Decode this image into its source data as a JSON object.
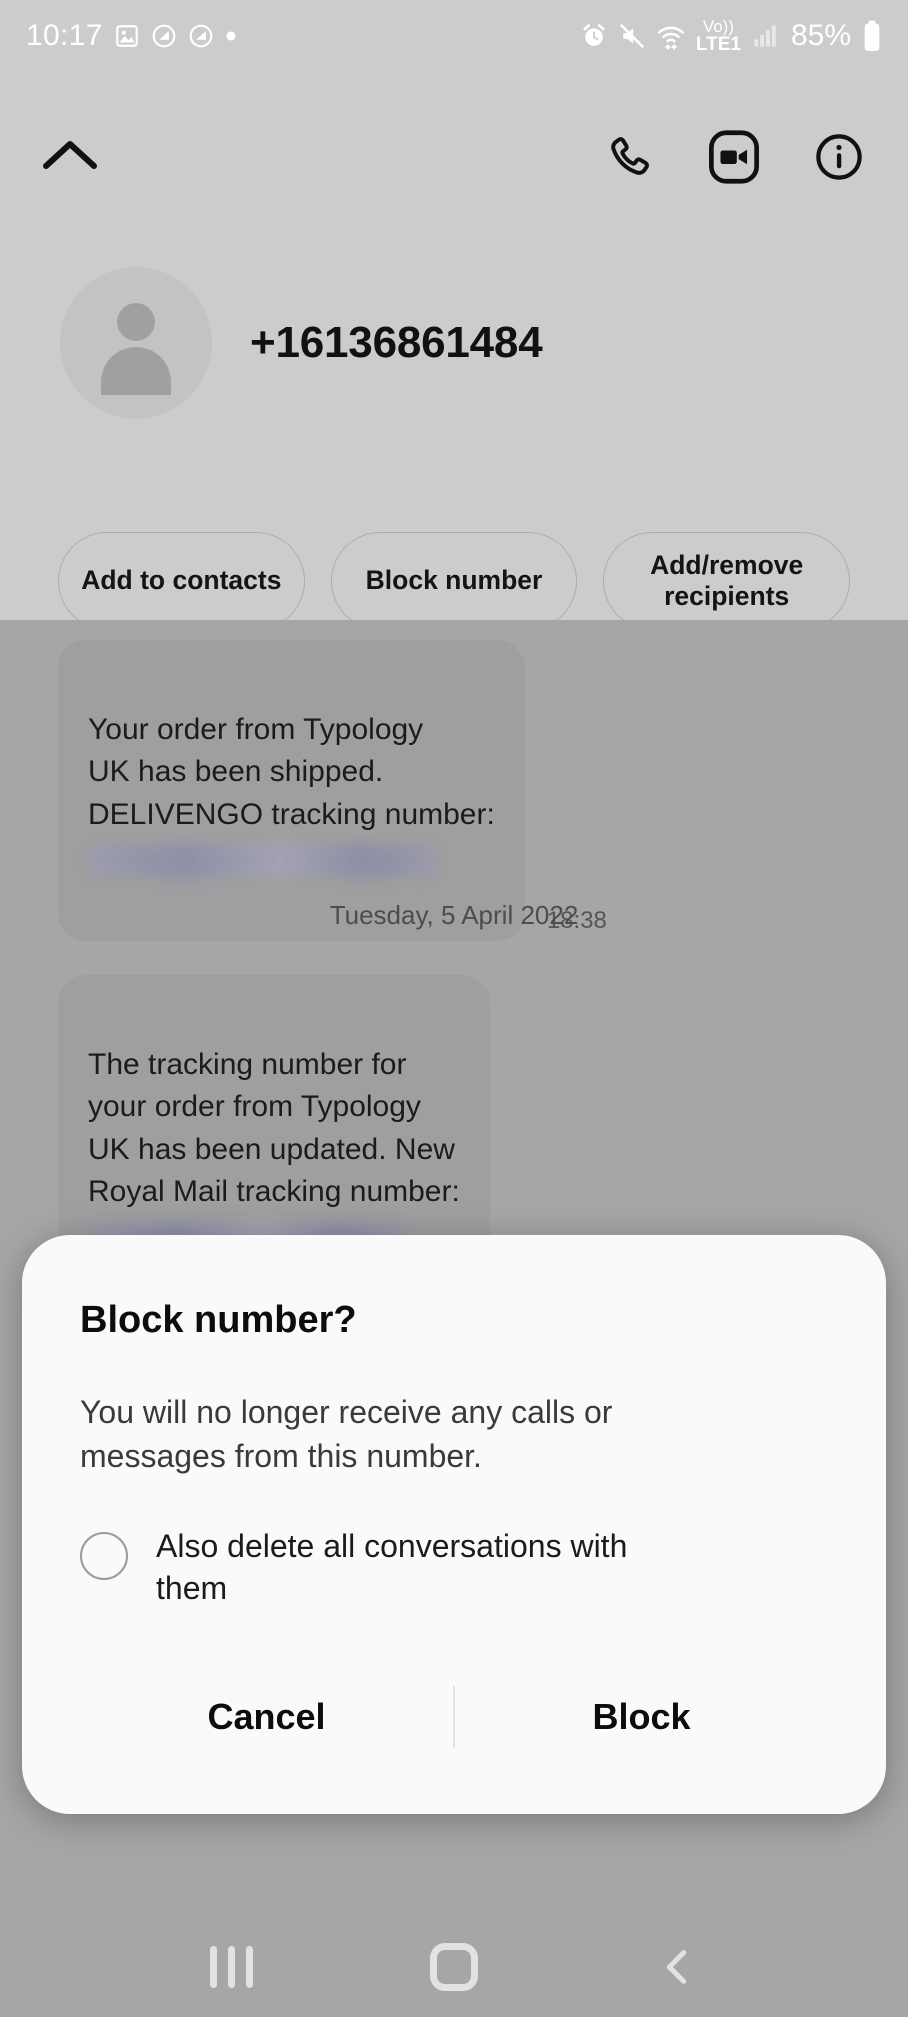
{
  "status_bar": {
    "time": "10:17",
    "battery_percent": "85%",
    "network_label": "Vo))",
    "network_sub": "LTE1",
    "left_icons": [
      "image-icon",
      "no-sound-icon",
      "no-sound-icon",
      "dot-icon"
    ],
    "right_icons": [
      "alarm-icon",
      "mute-icon",
      "wifi-icon",
      "volte-icon",
      "signal-icon",
      "battery-icon"
    ]
  },
  "header": {
    "collapse_icon": "chevron-up-icon",
    "call_icon": "phone-icon",
    "video_icon": "video-camera-icon",
    "info_icon": "info-icon",
    "contact_number": "+16136861484",
    "avatar_icon": "person-avatar-icon",
    "chips": [
      {
        "label": "Add to\ncontacts",
        "name": "add-to-contacts"
      },
      {
        "label": "Block number",
        "name": "block-number"
      },
      {
        "label": "Add/remove\nrecipients",
        "name": "add-remove-recipients"
      }
    ]
  },
  "conversation": {
    "date_divider": "Tuesday, 5 April 2022",
    "messages": [
      {
        "text": "Your order from Typology\nUK has been shipped.\nDELIVENGO tracking number:",
        "redacted": true,
        "time": "18:38"
      },
      {
        "text": "The tracking number for\nyour order from Typology\nUK has been updated. New\nRoyal Mail tracking number:",
        "redacted": true,
        "time": ""
      }
    ]
  },
  "dialog": {
    "title": "Block number?",
    "body": "You will no longer receive any calls or\nmessages from this number.",
    "checkbox_label": "Also delete all conversations with\nthem",
    "checkbox_checked": false,
    "cancel_label": "Cancel",
    "confirm_label": "Block"
  },
  "nav_bar": {
    "recents_icon": "recents-icon",
    "home_icon": "home-icon",
    "back_icon": "back-chevron-icon"
  },
  "colors": {
    "header_bg": "#cccccc",
    "chat_bg": "#a6a6a6",
    "bubble_bg": "#9f9f9f",
    "dialog_bg": "#fafafa",
    "text_primary": "#111111"
  }
}
